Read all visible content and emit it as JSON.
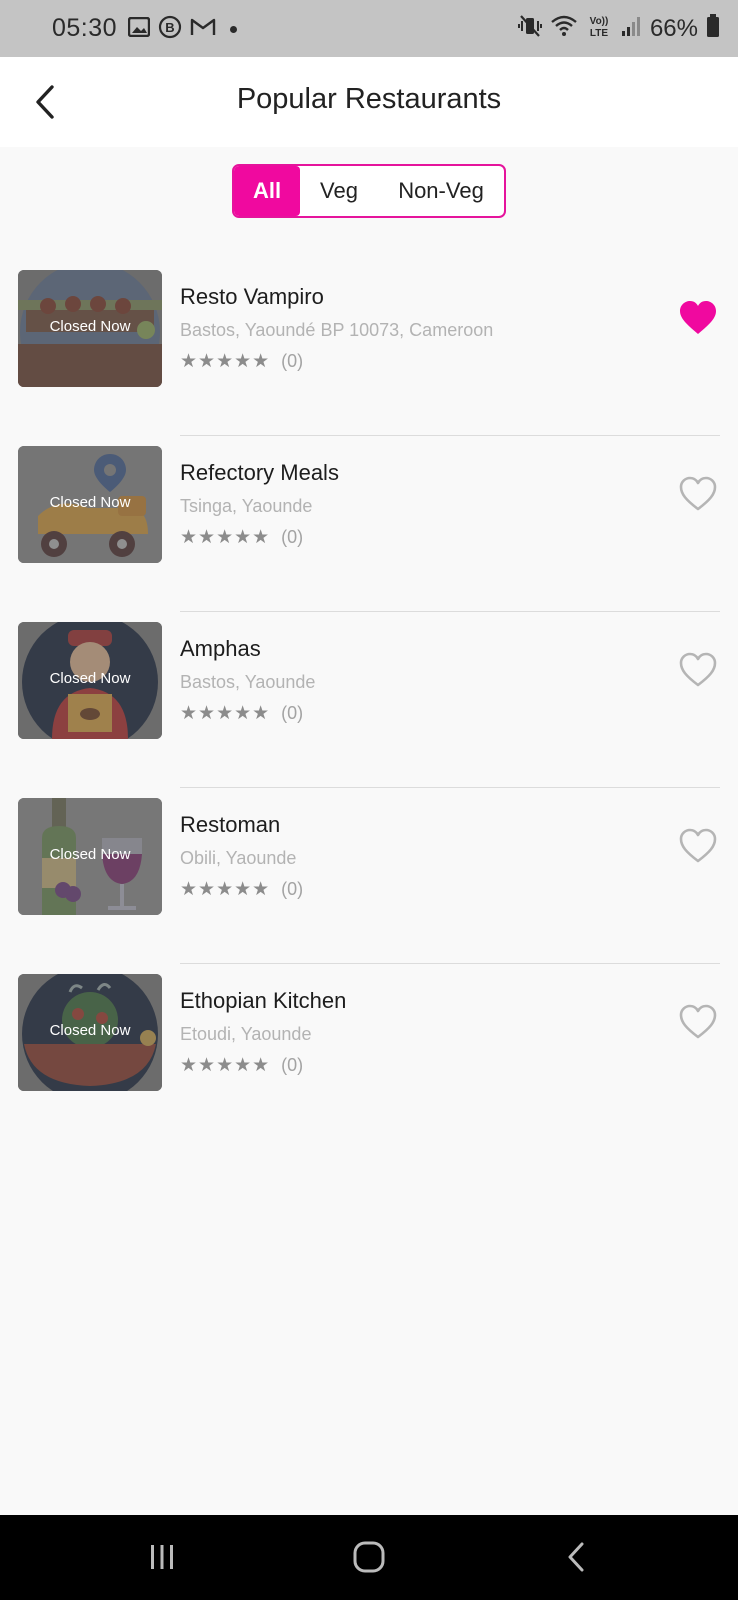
{
  "status_bar": {
    "time": "05:30",
    "left_icons": [
      "gallery-icon",
      "whatsapp-business-icon",
      "gmail-icon"
    ],
    "right_icons": [
      "mute-vibrate-icon",
      "wifi-icon",
      "volte-icon",
      "signal-icon"
    ],
    "battery": "66%"
  },
  "header": {
    "title": "Popular Restaurants",
    "back_icon": "chevron-left-icon"
  },
  "filters": {
    "tabs": [
      {
        "label": "All",
        "active": true
      },
      {
        "label": "Veg",
        "active": false
      },
      {
        "label": "Non-Veg",
        "active": false
      }
    ]
  },
  "restaurants": [
    {
      "name": "Resto Vampiro",
      "address": "Bastos, Yaoundé BP 10073, Cameroon",
      "status": "Closed Now",
      "stars": "★★★★★",
      "rating_count": "(0)",
      "favorite": true
    },
    {
      "name": "Refectory Meals",
      "address": "Tsinga, Yaounde",
      "status": "Closed Now",
      "stars": "★★★★★",
      "rating_count": "(0)",
      "favorite": false
    },
    {
      "name": "Amphas",
      "address": "Bastos, Yaounde",
      "status": "Closed Now",
      "stars": "★★★★★",
      "rating_count": "(0)",
      "favorite": false
    },
    {
      "name": "Restoman",
      "address": "Obili, Yaounde",
      "status": "Closed Now",
      "stars": "★★★★★",
      "rating_count": "(0)",
      "favorite": false
    },
    {
      "name": "Ethopian Kitchen",
      "address": "Etoudi, Yaounde",
      "status": "Closed Now",
      "stars": "★★★★★",
      "rating_count": "(0)",
      "favorite": false
    }
  ],
  "colors": {
    "accent": "#f0099f",
    "heart_filled": "#f0099f",
    "heart_outline": "#b5b5b5"
  },
  "nav_bar": {
    "icons": [
      "recent-apps-icon",
      "home-icon",
      "back-icon"
    ]
  }
}
